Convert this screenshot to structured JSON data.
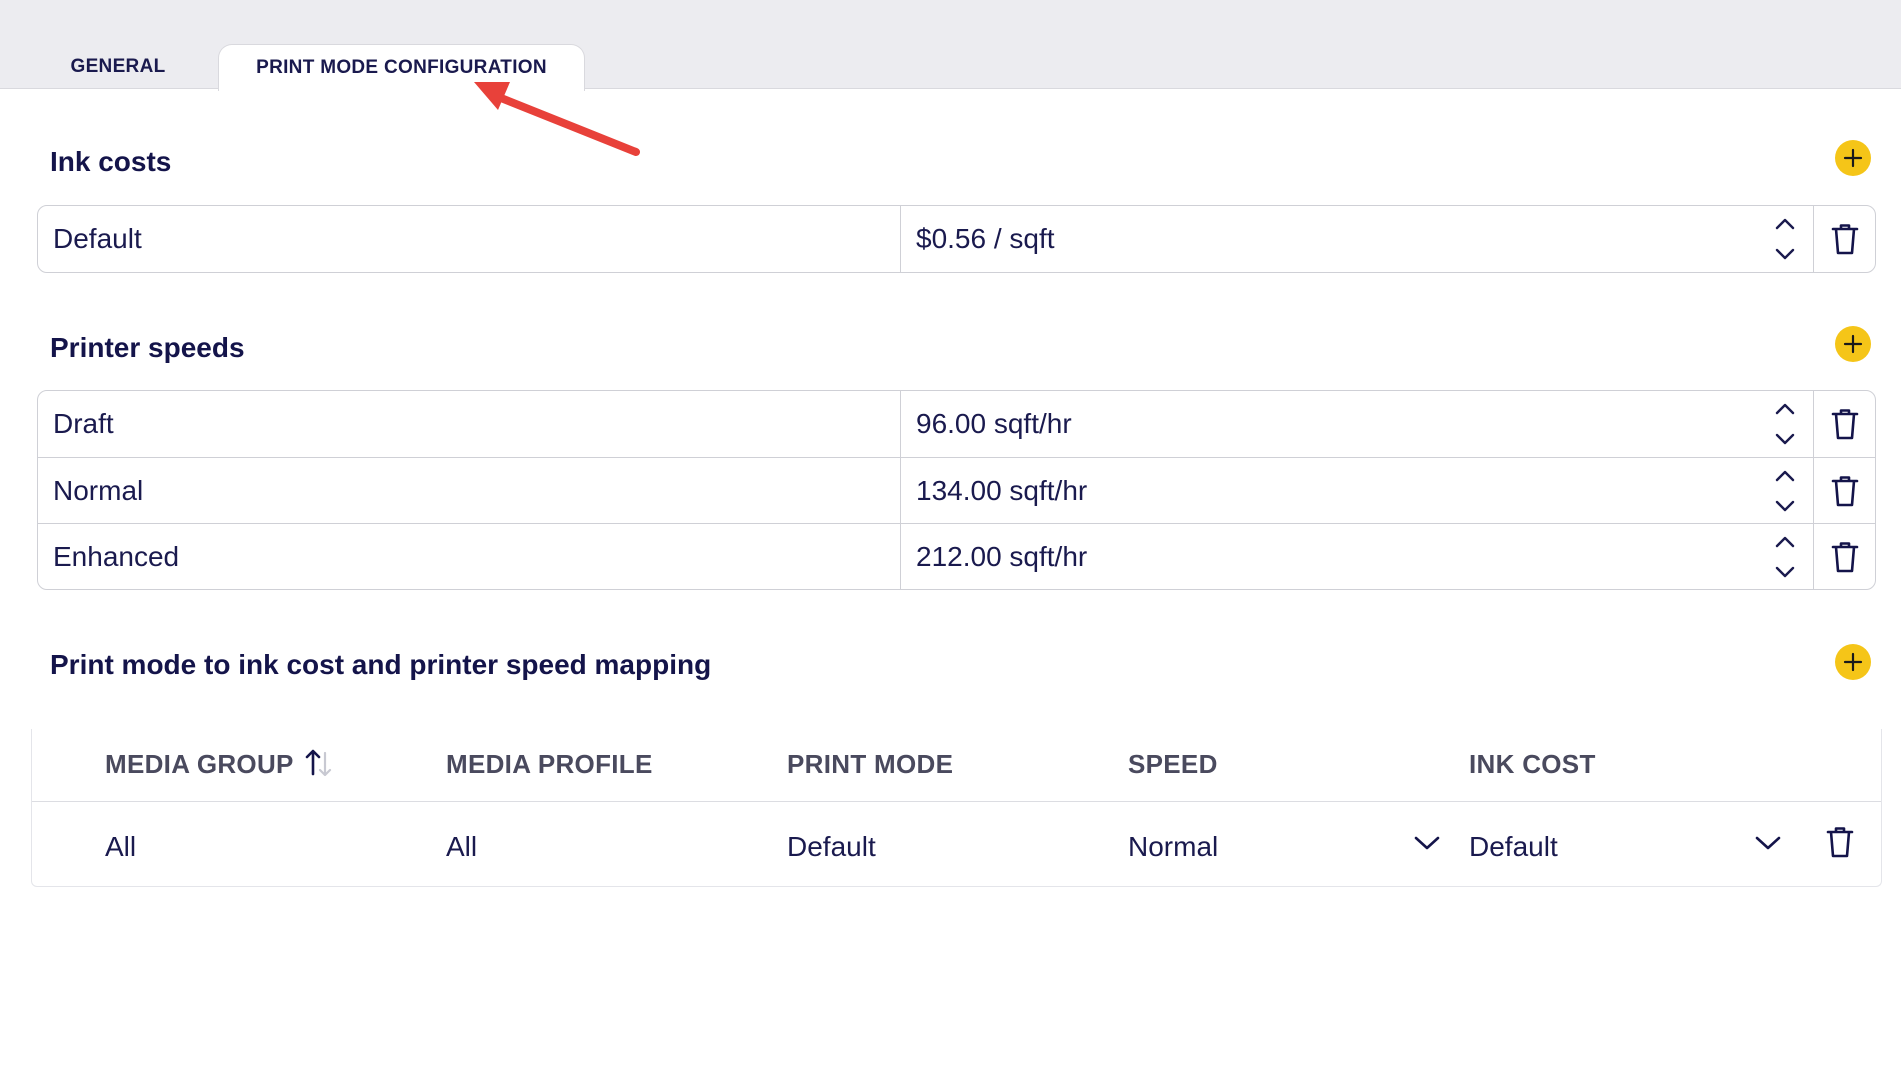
{
  "tabs": {
    "general": "GENERAL",
    "print_mode_configuration": "PRINT MODE CONFIGURATION",
    "active": "print_mode_configuration"
  },
  "ink_costs": {
    "title": "Ink costs",
    "rows": [
      {
        "name": "Default",
        "value": "$0.56 / sqft"
      }
    ]
  },
  "printer_speeds": {
    "title": "Printer speeds",
    "rows": [
      {
        "name": "Draft",
        "value": "96.00 sqft/hr"
      },
      {
        "name": "Normal",
        "value": "134.00 sqft/hr"
      },
      {
        "name": "Enhanced",
        "value": "212.00 sqft/hr"
      }
    ]
  },
  "mapping": {
    "title": "Print mode to ink cost and printer speed mapping",
    "columns": {
      "media_group": "MEDIA GROUP",
      "media_profile": "MEDIA PROFILE",
      "print_mode": "PRINT MODE",
      "speed": "SPEED",
      "ink_cost": "INK COST"
    },
    "rows": [
      {
        "media_group": "All",
        "media_profile": "All",
        "print_mode": "Default",
        "speed": "Normal",
        "ink_cost": "Default"
      }
    ]
  },
  "colors": {
    "accent": "#f5c518",
    "text": "#1a1a4e",
    "annotation_arrow": "#e8413a"
  },
  "icons": [
    "plus-icon",
    "stepper-up-icon",
    "stepper-down-icon",
    "trash-icon",
    "sort-icon",
    "chevron-down-icon"
  ]
}
